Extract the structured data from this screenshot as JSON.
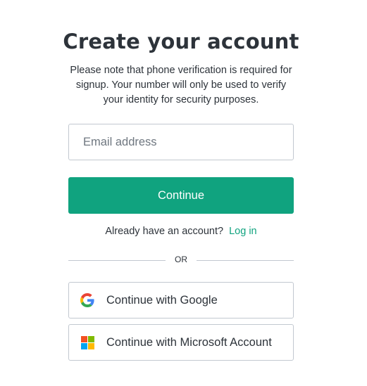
{
  "page": {
    "title": "Create your account",
    "subtitle": "Please note that phone verification is required for signup. Your number will only be used to verify your identity for security purposes."
  },
  "form": {
    "email_placeholder": "Email address",
    "email_value": "",
    "continue_label": "Continue"
  },
  "login": {
    "prompt": "Already have an account?",
    "link_label": "Log in"
  },
  "divider": {
    "label": "OR"
  },
  "social": {
    "google_label": "Continue with Google",
    "microsoft_label": "Continue with Microsoft Account"
  },
  "colors": {
    "accent": "#10a37f",
    "text": "#2d333a",
    "border": "#c2c8d0",
    "google_blue": "#4285F4",
    "google_green": "#34A853",
    "google_yellow": "#FBBC05",
    "google_red": "#EA4335",
    "ms_red": "#F25022",
    "ms_green": "#7FBA00",
    "ms_blue": "#00A4EF",
    "ms_yellow": "#FFB900"
  },
  "icons": {
    "google": "google-logo-icon",
    "microsoft": "microsoft-logo-icon"
  }
}
